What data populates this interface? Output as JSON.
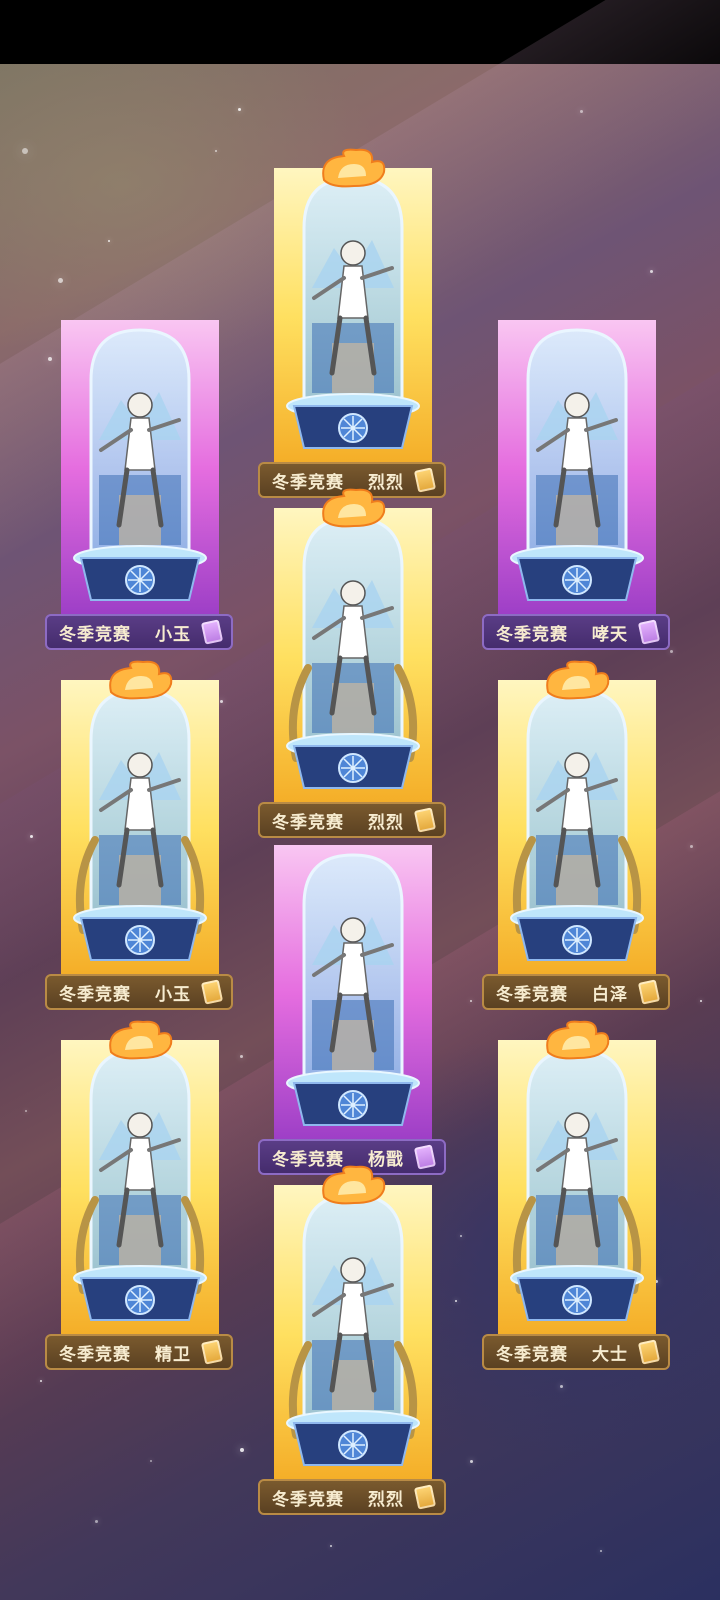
{
  "colors": {
    "gold_glow": "#ffe060",
    "purple_glow": "#e56ddf",
    "label_gold": "#6a4d28",
    "label_purple": "#4f3479",
    "label_text": "#f7ecd0"
  },
  "cards": [
    {
      "title": "冬季竞赛",
      "name": "烈烈",
      "rarity": "gold",
      "flame": true,
      "wreath": false
    },
    {
      "title": "冬季竞赛",
      "name": "小玉",
      "rarity": "purple",
      "flame": false,
      "wreath": false
    },
    {
      "title": "冬季竞赛",
      "name": "哮天",
      "rarity": "purple",
      "flame": false,
      "wreath": false
    },
    {
      "title": "冬季竞赛",
      "name": "烈烈",
      "rarity": "gold",
      "flame": true,
      "wreath": true
    },
    {
      "title": "冬季竞赛",
      "name": "小玉",
      "rarity": "gold",
      "flame": true,
      "wreath": true
    },
    {
      "title": "冬季竞赛",
      "name": "白泽",
      "rarity": "gold",
      "flame": true,
      "wreath": true
    },
    {
      "title": "冬季竞赛",
      "name": "杨戬",
      "rarity": "purple",
      "flame": false,
      "wreath": false
    },
    {
      "title": "冬季竞赛",
      "name": "精卫",
      "rarity": "gold",
      "flame": true,
      "wreath": true
    },
    {
      "title": "冬季竞赛",
      "name": "大士",
      "rarity": "gold",
      "flame": true,
      "wreath": true
    },
    {
      "title": "冬季竞赛",
      "name": "烈烈",
      "rarity": "gold",
      "flame": true,
      "wreath": true
    }
  ]
}
